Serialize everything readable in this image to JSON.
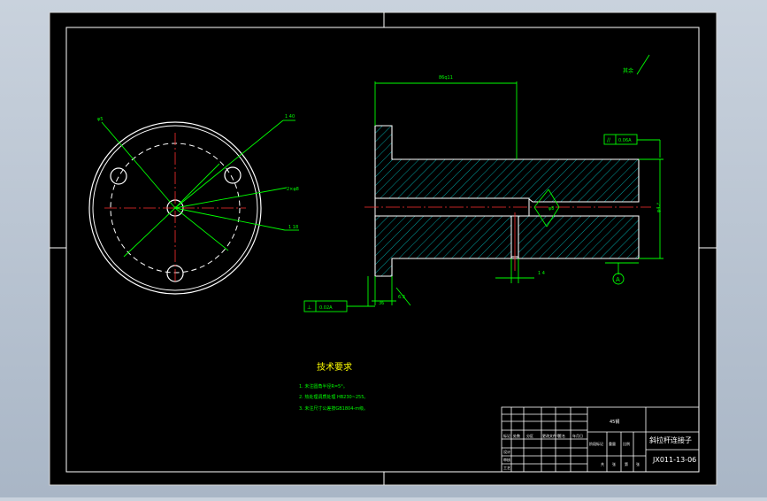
{
  "colors": {
    "background": "#b7c2cf",
    "sheet": "#000000",
    "frame": "#ffffff",
    "geometry": "#ffffff",
    "dimension": "#00ff00",
    "centerline": "#ff2020",
    "hatch": "#00c8c8",
    "note_heading": "#ffff00",
    "note_text": "#00ff00"
  },
  "drawing": {
    "dimensions": {
      "overall_length": "86q11",
      "diameter_right": "φ4₋ᵖ",
      "note_4": "1 4",
      "bore_note": "φ8",
      "hole_note": "φ5",
      "angle_note": "1 40",
      "left_side_note": "2×φ8",
      "bottom_radial": "1 18",
      "flange_width": "36"
    },
    "datum_label": "A",
    "surface_finish_top": "其余",
    "surface_finish_bottom": "6.3",
    "tolerance_frame_right": {
      "symbol": "//",
      "value": "0.06A"
    },
    "tolerance_frame_left": {
      "symbol": "⊥",
      "value": "0.02A"
    }
  },
  "notes": {
    "heading": "技术要求",
    "lines": [
      "1. 未注圆角半径R=5°。",
      "2. 热处理调质处理 HB230~255。",
      "3. 未注尺寸公差按GB1804-m级。"
    ]
  },
  "title_block": {
    "material": "45钢",
    "part_name": "斜拉杆连接子",
    "drawing_number": "JX011-13-06",
    "row_labels": [
      "标记",
      "设计",
      "审核",
      "工艺"
    ],
    "col_labels": [
      "处数",
      "分区",
      "更改文件号",
      "签名",
      "年月日"
    ],
    "stage_label": "阶段标记",
    "weight_label": "重量",
    "scale_label": "比例",
    "sheet_labels": [
      "共",
      "张",
      "第",
      "张"
    ]
  }
}
